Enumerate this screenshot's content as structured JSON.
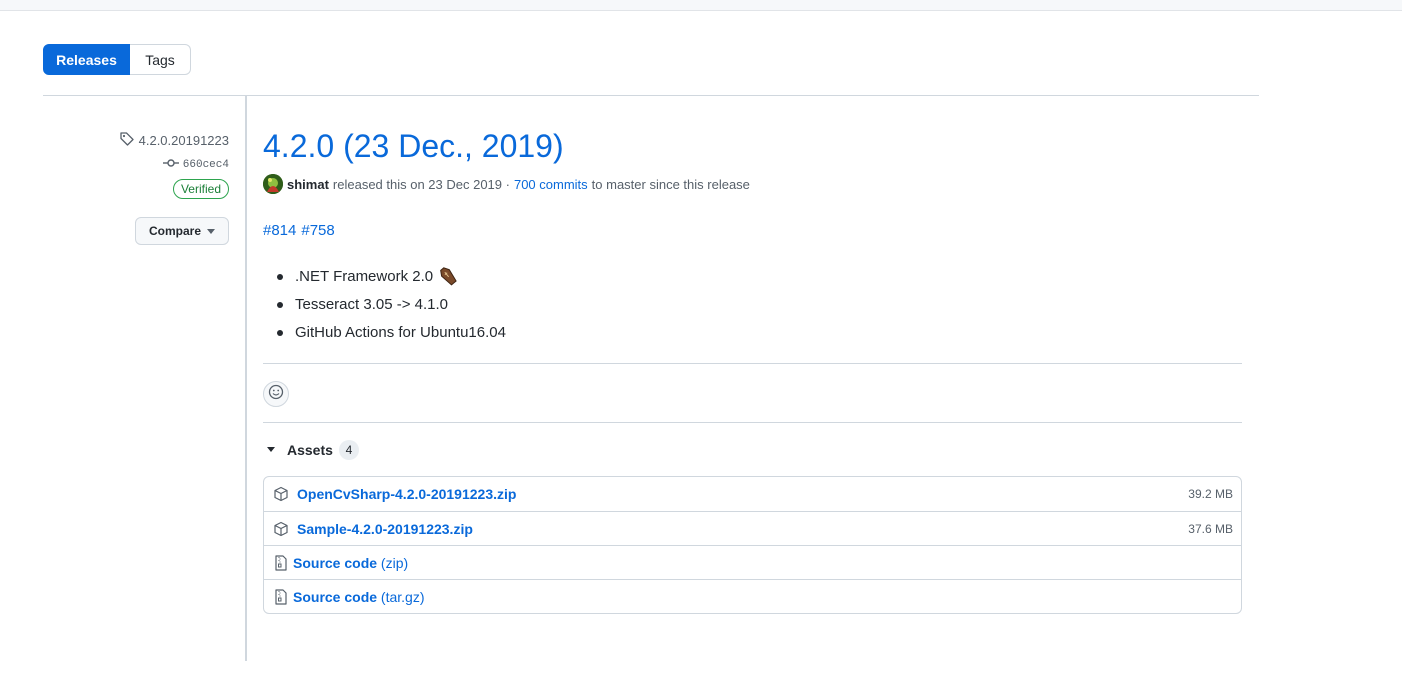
{
  "tabs": {
    "releases": "Releases",
    "tags": "Tags"
  },
  "meta": {
    "tag": "4.2.0.20191223",
    "commit": "660cec4",
    "verified": "Verified",
    "compare": "Compare"
  },
  "release": {
    "title": "4.2.0 (23 Dec., 2019)",
    "author": "shimat",
    "released_text": "released this on 23 Dec 2019 ·",
    "commits_link": "700 commits",
    "since_text": "to master since this release",
    "issues": [
      "#814",
      "#758"
    ],
    "notes": [
      ".NET Framework 2.0",
      "Tesseract 3.05 -> 4.1.0",
      "GitHub Actions for Ubuntu16.04"
    ]
  },
  "assets": {
    "label": "Assets",
    "count": "4",
    "files": [
      {
        "name": "OpenCvSharp-4.2.0-20191223.zip",
        "size": "39.2 MB"
      },
      {
        "name": "Sample-4.2.0-20191223.zip",
        "size": "37.6 MB"
      }
    ],
    "sources": [
      {
        "name": "Source code",
        "format": "(zip)"
      },
      {
        "name": "Source code",
        "format": "(tar.gz)"
      }
    ]
  },
  "colors": {
    "accent": "#0969da",
    "verified": "#1a7f37",
    "border": "#d0d7de"
  },
  "icons": [
    "tag-icon",
    "commit-icon",
    "triangle-down-icon",
    "smiley-icon",
    "package-icon",
    "file-zip-icon",
    "coffin-icon"
  ]
}
